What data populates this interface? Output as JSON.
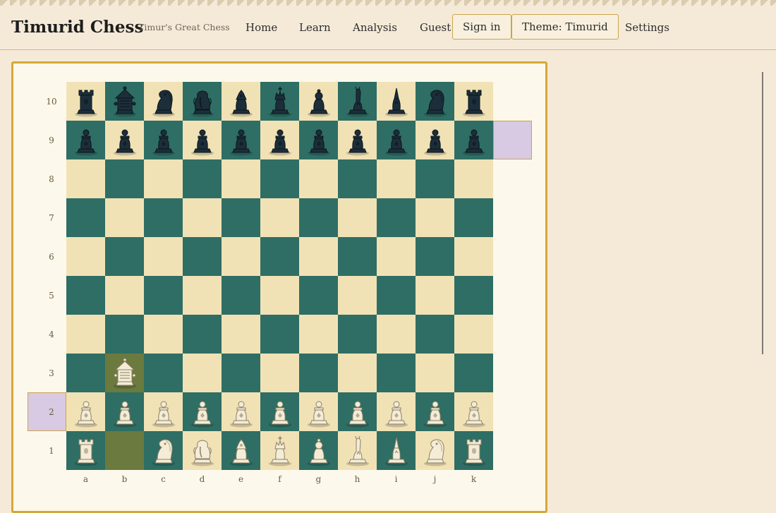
{
  "header": {
    "brand": "Timurid Chess",
    "tagline": "Timur's Great Chess",
    "nav": [
      "Home",
      "Learn",
      "Analysis"
    ],
    "guest_label": "Guest",
    "signin_label": "Sign in",
    "theme_label": "Theme: Timurid",
    "settings_label": "Settings"
  },
  "board": {
    "files": [
      "a",
      "b",
      "c",
      "d",
      "e",
      "f",
      "g",
      "h",
      "i",
      "j",
      "k"
    ],
    "ranks": [
      "10",
      "9",
      "8",
      "7",
      "6",
      "5",
      "4",
      "3",
      "2",
      "1"
    ],
    "colors": {
      "light_square": "#f1e2b6",
      "dark_square": "#2e6e64",
      "highlight_square": "#6b7a3f",
      "citadel": "#d8cae2",
      "black_piece": "#1c2e3a",
      "white_piece": "#f4ecd6",
      "frame": "#d3a936"
    },
    "last_move_squares": [
      "b1",
      "b3"
    ],
    "citadel_squares": [
      "l9",
      "z2"
    ],
    "pieces": [
      {
        "sq": "a10",
        "color": "black",
        "type": "rook"
      },
      {
        "sq": "b10",
        "color": "black",
        "type": "war-engine"
      },
      {
        "sq": "c10",
        "color": "black",
        "type": "knight"
      },
      {
        "sq": "d10",
        "color": "black",
        "type": "elephant"
      },
      {
        "sq": "e10",
        "color": "black",
        "type": "vizier"
      },
      {
        "sq": "f10",
        "color": "black",
        "type": "king"
      },
      {
        "sq": "g10",
        "color": "black",
        "type": "general"
      },
      {
        "sq": "h10",
        "color": "black",
        "type": "giraffe"
      },
      {
        "sq": "i10",
        "color": "black",
        "type": "scout"
      },
      {
        "sq": "j10",
        "color": "black",
        "type": "knight"
      },
      {
        "sq": "k10",
        "color": "black",
        "type": "rook"
      },
      {
        "sq": "a9",
        "color": "black",
        "type": "pawn"
      },
      {
        "sq": "b9",
        "color": "black",
        "type": "pawn"
      },
      {
        "sq": "c9",
        "color": "black",
        "type": "pawn"
      },
      {
        "sq": "d9",
        "color": "black",
        "type": "pawn"
      },
      {
        "sq": "e9",
        "color": "black",
        "type": "pawn"
      },
      {
        "sq": "f9",
        "color": "black",
        "type": "pawn"
      },
      {
        "sq": "g9",
        "color": "black",
        "type": "pawn"
      },
      {
        "sq": "h9",
        "color": "black",
        "type": "pawn"
      },
      {
        "sq": "i9",
        "color": "black",
        "type": "pawn"
      },
      {
        "sq": "j9",
        "color": "black",
        "type": "pawn"
      },
      {
        "sq": "k9",
        "color": "black",
        "type": "pawn"
      },
      {
        "sq": "b3",
        "color": "white",
        "type": "war-engine"
      },
      {
        "sq": "a2",
        "color": "white",
        "type": "pawn"
      },
      {
        "sq": "b2",
        "color": "white",
        "type": "pawn"
      },
      {
        "sq": "c2",
        "color": "white",
        "type": "pawn"
      },
      {
        "sq": "d2",
        "color": "white",
        "type": "pawn"
      },
      {
        "sq": "e2",
        "color": "white",
        "type": "pawn"
      },
      {
        "sq": "f2",
        "color": "white",
        "type": "pawn"
      },
      {
        "sq": "g2",
        "color": "white",
        "type": "pawn"
      },
      {
        "sq": "h2",
        "color": "white",
        "type": "pawn"
      },
      {
        "sq": "i2",
        "color": "white",
        "type": "pawn"
      },
      {
        "sq": "j2",
        "color": "white",
        "type": "pawn"
      },
      {
        "sq": "k2",
        "color": "white",
        "type": "pawn"
      },
      {
        "sq": "a1",
        "color": "white",
        "type": "rook"
      },
      {
        "sq": "c1",
        "color": "white",
        "type": "knight"
      },
      {
        "sq": "d1",
        "color": "white",
        "type": "elephant"
      },
      {
        "sq": "e1",
        "color": "white",
        "type": "vizier"
      },
      {
        "sq": "f1",
        "color": "white",
        "type": "king"
      },
      {
        "sq": "g1",
        "color": "white",
        "type": "general"
      },
      {
        "sq": "h1",
        "color": "white",
        "type": "giraffe"
      },
      {
        "sq": "i1",
        "color": "white",
        "type": "scout"
      },
      {
        "sq": "j1",
        "color": "white",
        "type": "knight"
      },
      {
        "sq": "k1",
        "color": "white",
        "type": "rook"
      }
    ]
  }
}
